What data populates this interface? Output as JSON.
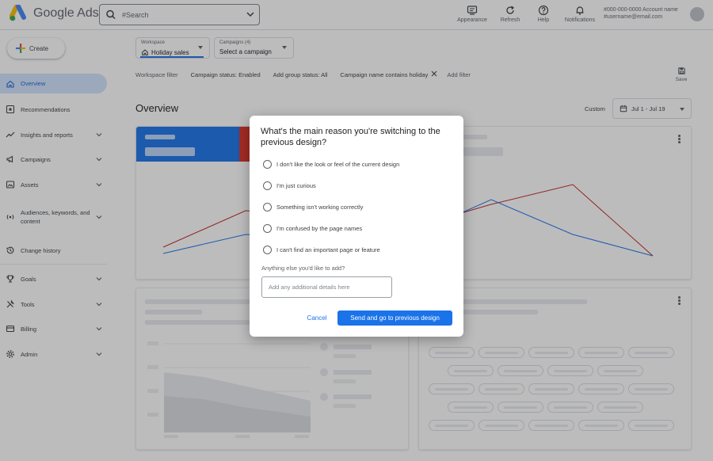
{
  "app": {
    "product_name": "Google Ads"
  },
  "search": {
    "placeholder": "#Search"
  },
  "toolbar": {
    "appearance_label": "Appearance",
    "refresh_label": "Refresh",
    "help_label": "Help",
    "notifications_label": "Notifications"
  },
  "account": {
    "line1": "#000-000-0000 Account name",
    "line2": "#username@email.com"
  },
  "sidebar": {
    "create_label": "Create",
    "items": [
      {
        "label": "Overview",
        "icon": "home-icon"
      },
      {
        "label": "Recommendations",
        "icon": "recommendations-icon"
      },
      {
        "label": "Insights and reports",
        "icon": "trending-icon"
      },
      {
        "label": "Campaigns",
        "icon": "megaphone-icon"
      },
      {
        "label": "Assets",
        "icon": "assets-icon"
      },
      {
        "label": "Audiences, keywords, and content",
        "icon": "audience-icon"
      },
      {
        "label": "Change history",
        "icon": "history-icon"
      },
      {
        "label": "Goals",
        "icon": "trophy-icon"
      },
      {
        "label": "Tools",
        "icon": "tools-icon"
      },
      {
        "label": "Billing",
        "icon": "card-icon"
      },
      {
        "label": "Admin",
        "icon": "gear-icon"
      }
    ]
  },
  "workspace": {
    "label": "Workspace",
    "value": "Holiday sales"
  },
  "campaigns": {
    "label": "Campaigns (4)",
    "value": "Select a campaign"
  },
  "filters": {
    "workspace_filter": "Workspace filter",
    "campaign_status": "Campaign status: Enabled",
    "ad_group_status": "Add group status: All",
    "campaign_name": "Campaign name contains holiday",
    "add_filter": "Add filter"
  },
  "save_label": "Save",
  "overview": {
    "title": "Overview",
    "range_label": "Custom",
    "date_range": "Jul 1 - Jul 19"
  },
  "dialog": {
    "question": "What's the main reason you're switching to the previous design?",
    "options": [
      "I don't like the look or feel of the current design",
      "I'm just curious",
      "Something isn't working correctly",
      "I'm confused by the page names",
      "I can't find an important page or feature"
    ],
    "more_label": "Anything else you'd like to add?",
    "details_placeholder": "Add any additional details here",
    "cancel_label": "Cancel",
    "send_label": "Send and go to previous design"
  },
  "colors": {
    "accent": "#1a73e8",
    "series_red": "#c5221f",
    "series_blue": "#1a73e8"
  }
}
